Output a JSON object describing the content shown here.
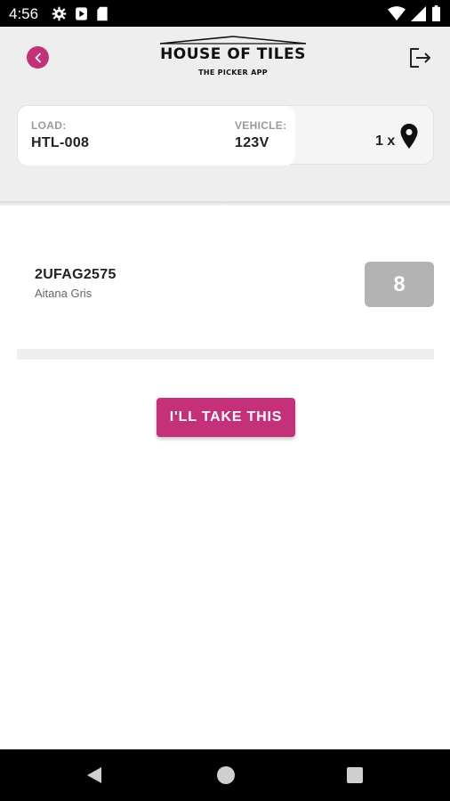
{
  "status_bar": {
    "time": "4:56",
    "icons_left": [
      "gear-icon",
      "play-icon",
      "sd-card-icon"
    ],
    "icons_right": [
      "wifi-icon",
      "signal-icon",
      "battery-icon"
    ]
  },
  "header": {
    "brand_title": "HOUSE OF TILES",
    "brand_subtitle": "THE PICKER APP",
    "accent_color": "#c4307a"
  },
  "load_info": {
    "load_label": "LOAD:",
    "load_value": "HTL-008",
    "vehicle_label": "VEHICLE:",
    "vehicle_value": "123V",
    "count_text": "1 x",
    "location_icon": "location-pin-icon"
  },
  "order": {
    "code": "2UFAG2575",
    "customer": "Aitana Gris",
    "quantity": "8"
  },
  "actions": {
    "take_label": "I'LL TAKE THIS"
  },
  "nav_bar": {
    "buttons": [
      "back-triangle-icon",
      "home-circle-icon",
      "recents-square-icon"
    ]
  }
}
